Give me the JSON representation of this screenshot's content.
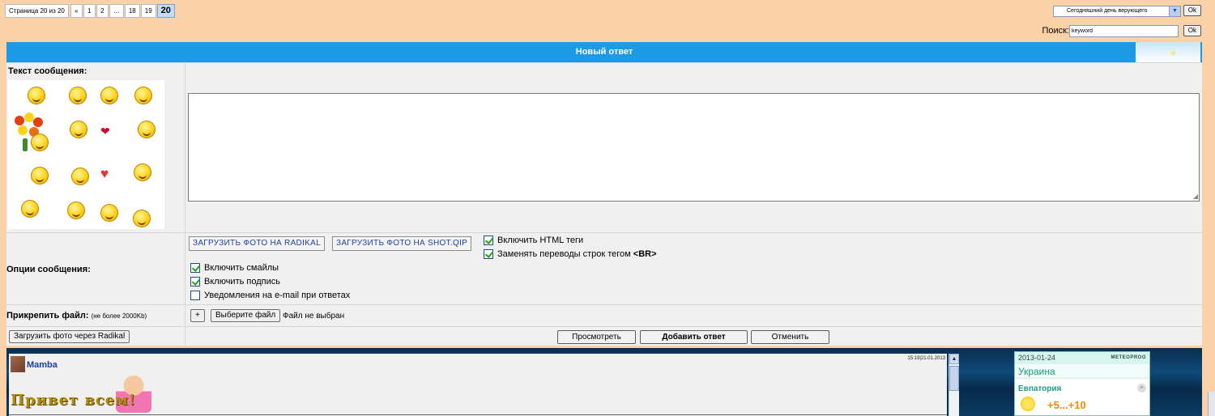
{
  "pagination": {
    "info": "Страница 20 из 20",
    "first": "«",
    "pages": [
      "1",
      "2",
      "…",
      "18",
      "19"
    ],
    "current": "20"
  },
  "top_controls": {
    "day_select_value": "Сегодняшний день верующего",
    "ok_label": "Ok",
    "search_label": "Поиск:",
    "search_value": "keyword"
  },
  "form": {
    "title": "Новый ответ",
    "message_label": "Текст сообщения:",
    "upload_radikal": "ЗАГРУЗИТЬ ФОТО НА RADIKAL",
    "upload_shotqip": "ЗАГРУЗИТЬ ФОТО НА SHOT.QIP",
    "options_label": "Опции сообщения:",
    "options": {
      "enable_html": "Включить HTML теги",
      "replace_breaks_prefix": "Заменять переводы строк тегом ",
      "replace_breaks_tag": "<BR>",
      "enable_smilies": "Включить смайлы",
      "enable_signature": "Включить подпись",
      "email_notify": "Уведомления на e-mail при ответах"
    },
    "checked": {
      "enable_html": true,
      "replace_breaks": true,
      "enable_smilies": true,
      "enable_signature": true,
      "email_notify": false
    },
    "attach_label": "Прикрепить файл:",
    "attach_note": "(не более 2000Kb)",
    "add_file_plus": "+",
    "choose_file": "Выберите файл",
    "no_file": "Файл не выбран",
    "upload_via_radikal": "Загрузить фото через Radikal",
    "preview": "Просмотреть",
    "submit": "Добавить ответ",
    "cancel": "Отменить"
  },
  "post": {
    "author": "Mamba",
    "timestamp": "15:19|21.01.2013",
    "greeting": "Привет всем!"
  },
  "weather": {
    "date": "2013-01-24",
    "brand": "METEOPROG",
    "country": "Украина",
    "city": "Евпатория",
    "temp": "+5...+10"
  },
  "colors": {
    "page_bg": "#fbd2a8",
    "header_blue": "#1c9ae5",
    "link_blue": "#1b3ea8",
    "weather_green": "#1d9c83",
    "temp_orange": "#f58a00"
  }
}
